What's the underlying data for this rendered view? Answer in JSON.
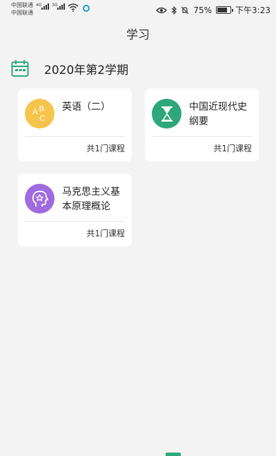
{
  "status_bar": {
    "carrier_1": "中国联通",
    "carrier_2": "中国联通",
    "network_1": "4G",
    "network_2": "3G",
    "battery_percent": "75%",
    "battery_level": 0.75,
    "time": "下午3:23"
  },
  "header": {
    "title": "学习"
  },
  "semester": {
    "title": "2020年第2学期",
    "icon": "calendar-icon",
    "accent_color": "#2ea77a"
  },
  "courses": [
    {
      "name": "英语（二）",
      "count_label": "共1门课程",
      "icon": "abc-icon",
      "color": "#f5c54b"
    },
    {
      "name": "中国近现代史纲要",
      "count_label": "共1门课程",
      "icon": "hourglass-icon",
      "color": "#2ea77a"
    },
    {
      "name": "马克思主义基本原理概论",
      "count_label": "共1门课程",
      "icon": "head-star-icon",
      "color": "#a06be0"
    }
  ],
  "bottom_nav": {
    "active_color": "#2ea77a"
  }
}
